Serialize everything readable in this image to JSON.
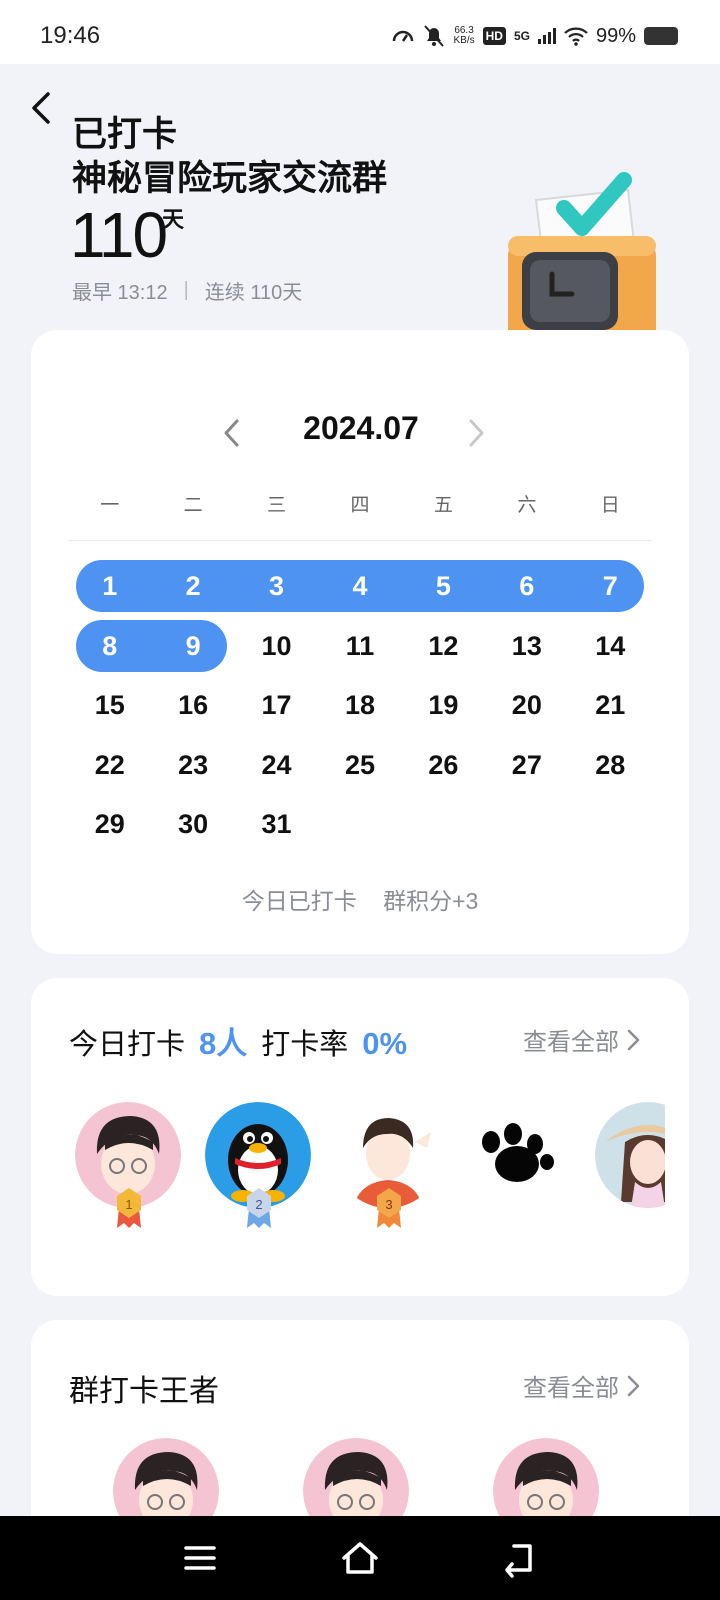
{
  "status_bar": {
    "time": "19:46",
    "net_speed_top": "66.3",
    "net_speed_bottom": "KB/s",
    "hd": "HD",
    "signal": "5G",
    "battery": "99%"
  },
  "header": {
    "status": "已打卡",
    "group_name": "神秘冒险玩家交流群",
    "days": "110",
    "days_unit": "天",
    "earliest": "最早 13:12",
    "separator": "|",
    "streak": "连续 110天"
  },
  "calendar": {
    "month": "2024.07",
    "weekdays": [
      "一",
      "二",
      "三",
      "四",
      "五",
      "六",
      "日"
    ],
    "weeks": [
      [
        1,
        2,
        3,
        4,
        5,
        6,
        7
      ],
      [
        8,
        9,
        10,
        11,
        12,
        13,
        14
      ],
      [
        15,
        16,
        17,
        18,
        19,
        20,
        21
      ],
      [
        22,
        23,
        24,
        25,
        26,
        27,
        28
      ],
      [
        29,
        30,
        31
      ]
    ],
    "checked_days": [
      1,
      2,
      3,
      4,
      5,
      6,
      7,
      8,
      9
    ],
    "footer_status": "今日已打卡",
    "footer_points": "群积分+3"
  },
  "today": {
    "label": "今日打卡",
    "count": "8人",
    "rate_label": "打卡率",
    "rate": "0%",
    "view_all": "查看全部",
    "ranks": [
      "1",
      "2",
      "3"
    ]
  },
  "kings": {
    "title": "群打卡王者",
    "view_all": "查看全部"
  },
  "colors": {
    "accent": "#4f93f2",
    "muted": "#8a8d95"
  }
}
